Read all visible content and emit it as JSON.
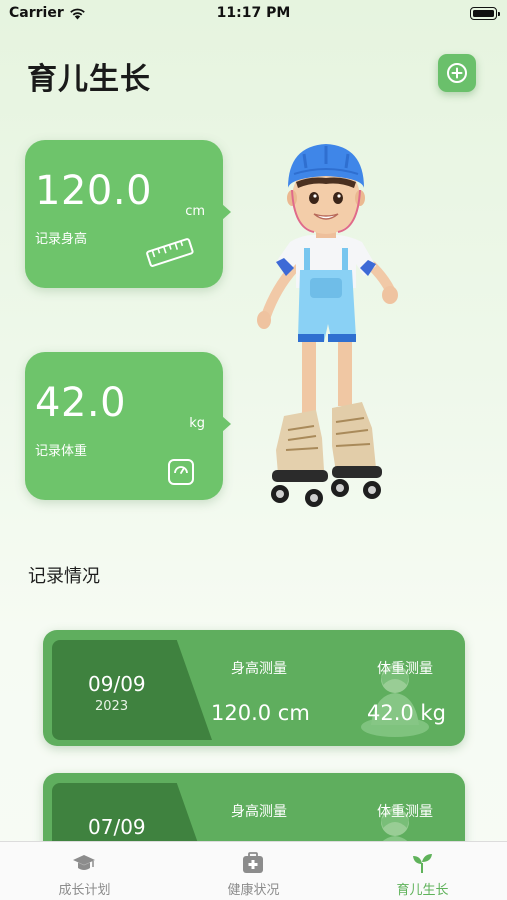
{
  "status_bar": {
    "carrier": "Carrier",
    "time": "11:17 PM"
  },
  "header": {
    "title": "育儿生长",
    "add_icon": "plus-circle-icon"
  },
  "metrics": {
    "height": {
      "value": "120.0",
      "unit": "cm",
      "label": "记录身高",
      "icon": "ruler-icon"
    },
    "weight": {
      "value": "42.0",
      "unit": "kg",
      "label": "记录体重",
      "icon": "scale-icon"
    }
  },
  "records_section": {
    "title": "记录情况",
    "records": [
      {
        "date": "09/09",
        "year": "2023",
        "height_label": "身高测量",
        "height_value": "120.0 cm",
        "weight_label": "体重测量",
        "weight_value": "42.0 kg"
      },
      {
        "date": "07/09",
        "year": "",
        "height_label": "身高测量",
        "height_value": "",
        "weight_label": "体重测量",
        "weight_value": ""
      }
    ]
  },
  "tabs": [
    {
      "label": "成长计划",
      "icon": "graduation-cap-icon"
    },
    {
      "label": "健康状况",
      "icon": "medical-kit-icon"
    },
    {
      "label": "育儿生长",
      "icon": "sprout-icon",
      "active": true
    }
  ],
  "colors": {
    "accent": "#6ec46b",
    "card_dark": "#3f823f",
    "card": "#5fae5e",
    "active_tab": "#5fb25a"
  }
}
